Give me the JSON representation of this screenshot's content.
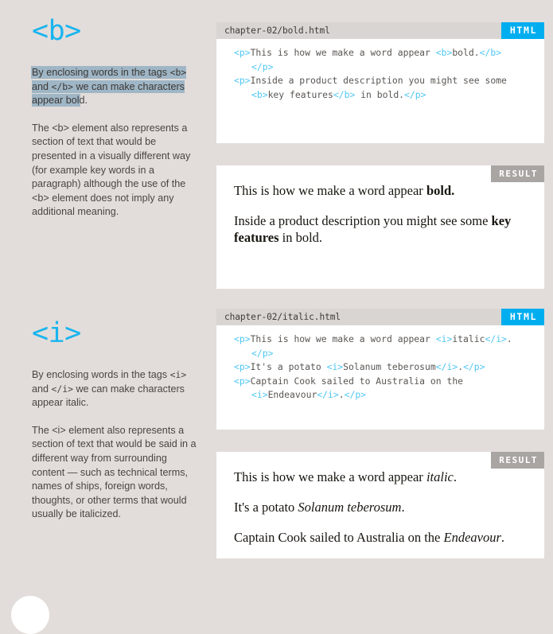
{
  "theme": {
    "page_bg": "#e2ddda",
    "accent": "#00aeef",
    "heading_color": "#19b4ef",
    "highlight_color": "#9fb6c6",
    "code_tag_color": "#4fc7f2",
    "result_badge_color": "#a9a5a2",
    "panel_bg": "#ffffff",
    "code_header_bg": "#d9d5d2"
  },
  "sections": [
    {
      "heading": "<b>",
      "intro": {
        "pre": "By enclosing words in the tags ",
        "tag_open": "<b>",
        "mid": " and ",
        "tag_close": "</b>",
        "post": " we can make characters appear bol",
        "tail": "d."
      },
      "body": "The <b> element also represents a section of text that would be presented in a visually different way (for example key words in a paragraph) although the use of the <b> element does not imply any additional meaning.",
      "code": {
        "filename": "chapter-02/bold.html",
        "badge": "HTML",
        "lines": [
          {
            "indent": false,
            "html": "<span class=\"t\">&lt;p&gt;</span>This is how we make a word appear <span class=\"t\">&lt;b&gt;</span>bold.<span class=\"t\">&lt;/b&gt;</span>"
          },
          {
            "indent": true,
            "html": "<span class=\"t\">&lt;/p&gt;</span>"
          },
          {
            "indent": false,
            "html": "<span class=\"t\">&lt;p&gt;</span>Inside a product description you might see some"
          },
          {
            "indent": true,
            "html": "<span class=\"t\">&lt;b&gt;</span>key features<span class=\"t\">&lt;/b&gt;</span> in bold.<span class=\"t\">&lt;/p&gt;</span>"
          }
        ]
      },
      "result": {
        "badge": "RESULT",
        "paragraphs": [
          "This is how we make a word appear <b>bold.</b>",
          "Inside a product description you might see some <b>key features</b> in bold."
        ]
      }
    },
    {
      "heading": "<i>",
      "intro": {
        "pre": "By enclosing words in the tags ",
        "tag_open": "<i>",
        "mid": " and ",
        "tag_close": "</i>",
        "post": " we can make characters appear italic.",
        "tail": ""
      },
      "body": "The <i> element also represents a section of text that would be said in a different way from surrounding content — such as technical terms, names of ships, foreign words, thoughts, or other terms that would usually be italicized.",
      "code": {
        "filename": "chapter-02/italic.html",
        "badge": "HTML",
        "lines": [
          {
            "indent": false,
            "html": "<span class=\"t\">&lt;p&gt;</span>This is how we make a word appear <span class=\"t\">&lt;i&gt;</span>italic<span class=\"t\">&lt;/i&gt;</span>."
          },
          {
            "indent": true,
            "html": "<span class=\"t\">&lt;/p&gt;</span>"
          },
          {
            "indent": false,
            "html": "<span class=\"t\">&lt;p&gt;</span>It's a potato <span class=\"t\">&lt;i&gt;</span>Solanum teberosum<span class=\"t\">&lt;/i&gt;</span>.<span class=\"t\">&lt;/p&gt;</span>"
          },
          {
            "indent": false,
            "html": "<span class=\"t\">&lt;p&gt;</span>Captain Cook sailed to Australia on the"
          },
          {
            "indent": true,
            "html": "<span class=\"t\">&lt;i&gt;</span>Endeavour<span class=\"t\">&lt;/i&gt;</span>.<span class=\"t\">&lt;/p&gt;</span>"
          }
        ]
      },
      "result": {
        "badge": "RESULT",
        "paragraphs": [
          "This is how we make a word appear <i>italic</i>.",
          "It's a potato <i>Solanum teberosum</i>.",
          "Captain Cook sailed to Australia on the <i>Endeavour</i>."
        ]
      }
    }
  ]
}
